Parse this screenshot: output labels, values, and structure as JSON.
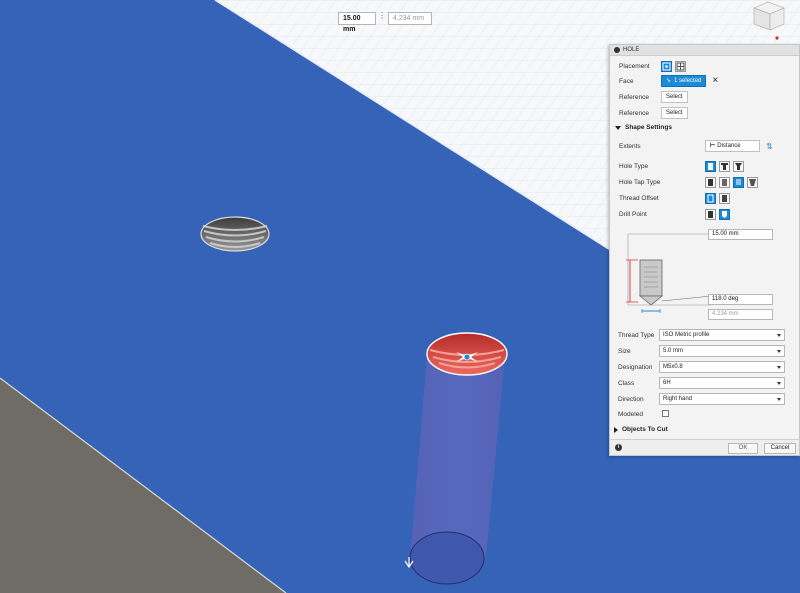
{
  "viewport": {
    "depth_value": "15.00 mm",
    "diameter_value": "4.234 mm"
  },
  "panel": {
    "title": "HOLE",
    "placement_label": "Placement",
    "face_label": "Face",
    "face_value": "1 selected",
    "reference_label_1": "Reference",
    "reference_value_1": "Select",
    "reference_label_2": "Reference",
    "reference_value_2": "Select",
    "shape_settings_label": "Shape Settings",
    "extents_label": "Extents",
    "extents_value": "Distance",
    "hole_type_label": "Hole Type",
    "hole_tap_type_label": "Hole Tap Type",
    "thread_offset_label": "Thread Offset",
    "drill_point_label": "Drill Point",
    "depth_field": "15.00 mm",
    "angle_field": "118.0 deg",
    "diameter_field": "4.234 mm",
    "thread_type_label": "Thread Type",
    "thread_type_value": "ISO Metric profile",
    "size_label": "Size",
    "size_value": "5.0 mm",
    "designation_label": "Designation",
    "designation_value": "M5x0.8",
    "class_label": "Class",
    "class_value": "6H",
    "direction_label": "Direction",
    "direction_value": "Right hand",
    "modeled_label": "Modeled",
    "objects_to_cut_label": "Objects To Cut",
    "ok_label": "OK",
    "cancel_label": "Cancel"
  },
  "colors": {
    "accent": "#1d8ad6",
    "surface_blue": "#3563b8",
    "selected_hole": "#d5413c"
  }
}
